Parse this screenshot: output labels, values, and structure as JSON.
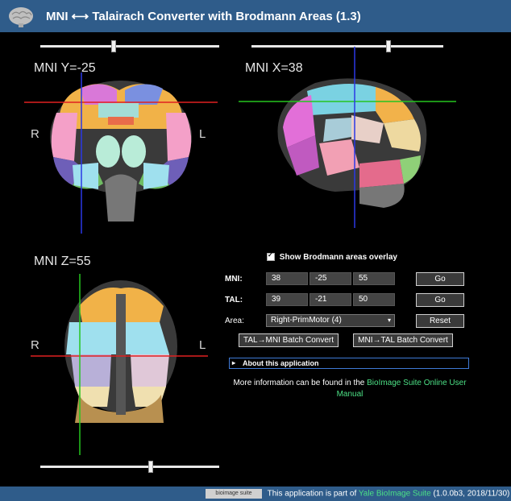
{
  "header": {
    "title": "MNI ⟷ Talairach Converter with Brodmann Areas (1.3)"
  },
  "views": {
    "coronal": {
      "label": "MNI Y=-25",
      "left": "R",
      "right": "L"
    },
    "sagittal": {
      "label": "MNI X=38"
    },
    "axial": {
      "label": "MNI Z=55",
      "left": "R",
      "right": "L"
    }
  },
  "controls": {
    "overlay_label": "Show Brodmann areas overlay",
    "overlay_checked": true,
    "mni_label": "MNI:",
    "mni": [
      "38",
      "-25",
      "55"
    ],
    "tal_label": "TAL:",
    "tal": [
      "39",
      "-21",
      "50"
    ],
    "go_label": "Go",
    "area_label": "Area:",
    "area_selected": "Right-PrimMotor (4)",
    "reset_label": "Reset",
    "tal_mni_batch": "TAL→MNI Batch Convert",
    "mni_tal_batch": "MNI→TAL Batch Convert",
    "about_label": "About this application",
    "info_prefix": "More information can be found in the ",
    "info_link": "BioImage Suite Online User Manual"
  },
  "footer": {
    "badge": "bioimage suite",
    "text": "This application is part of ",
    "link": "Yale BioImage Suite",
    "version": " (1.0.0b3, 2018/11/30)"
  }
}
